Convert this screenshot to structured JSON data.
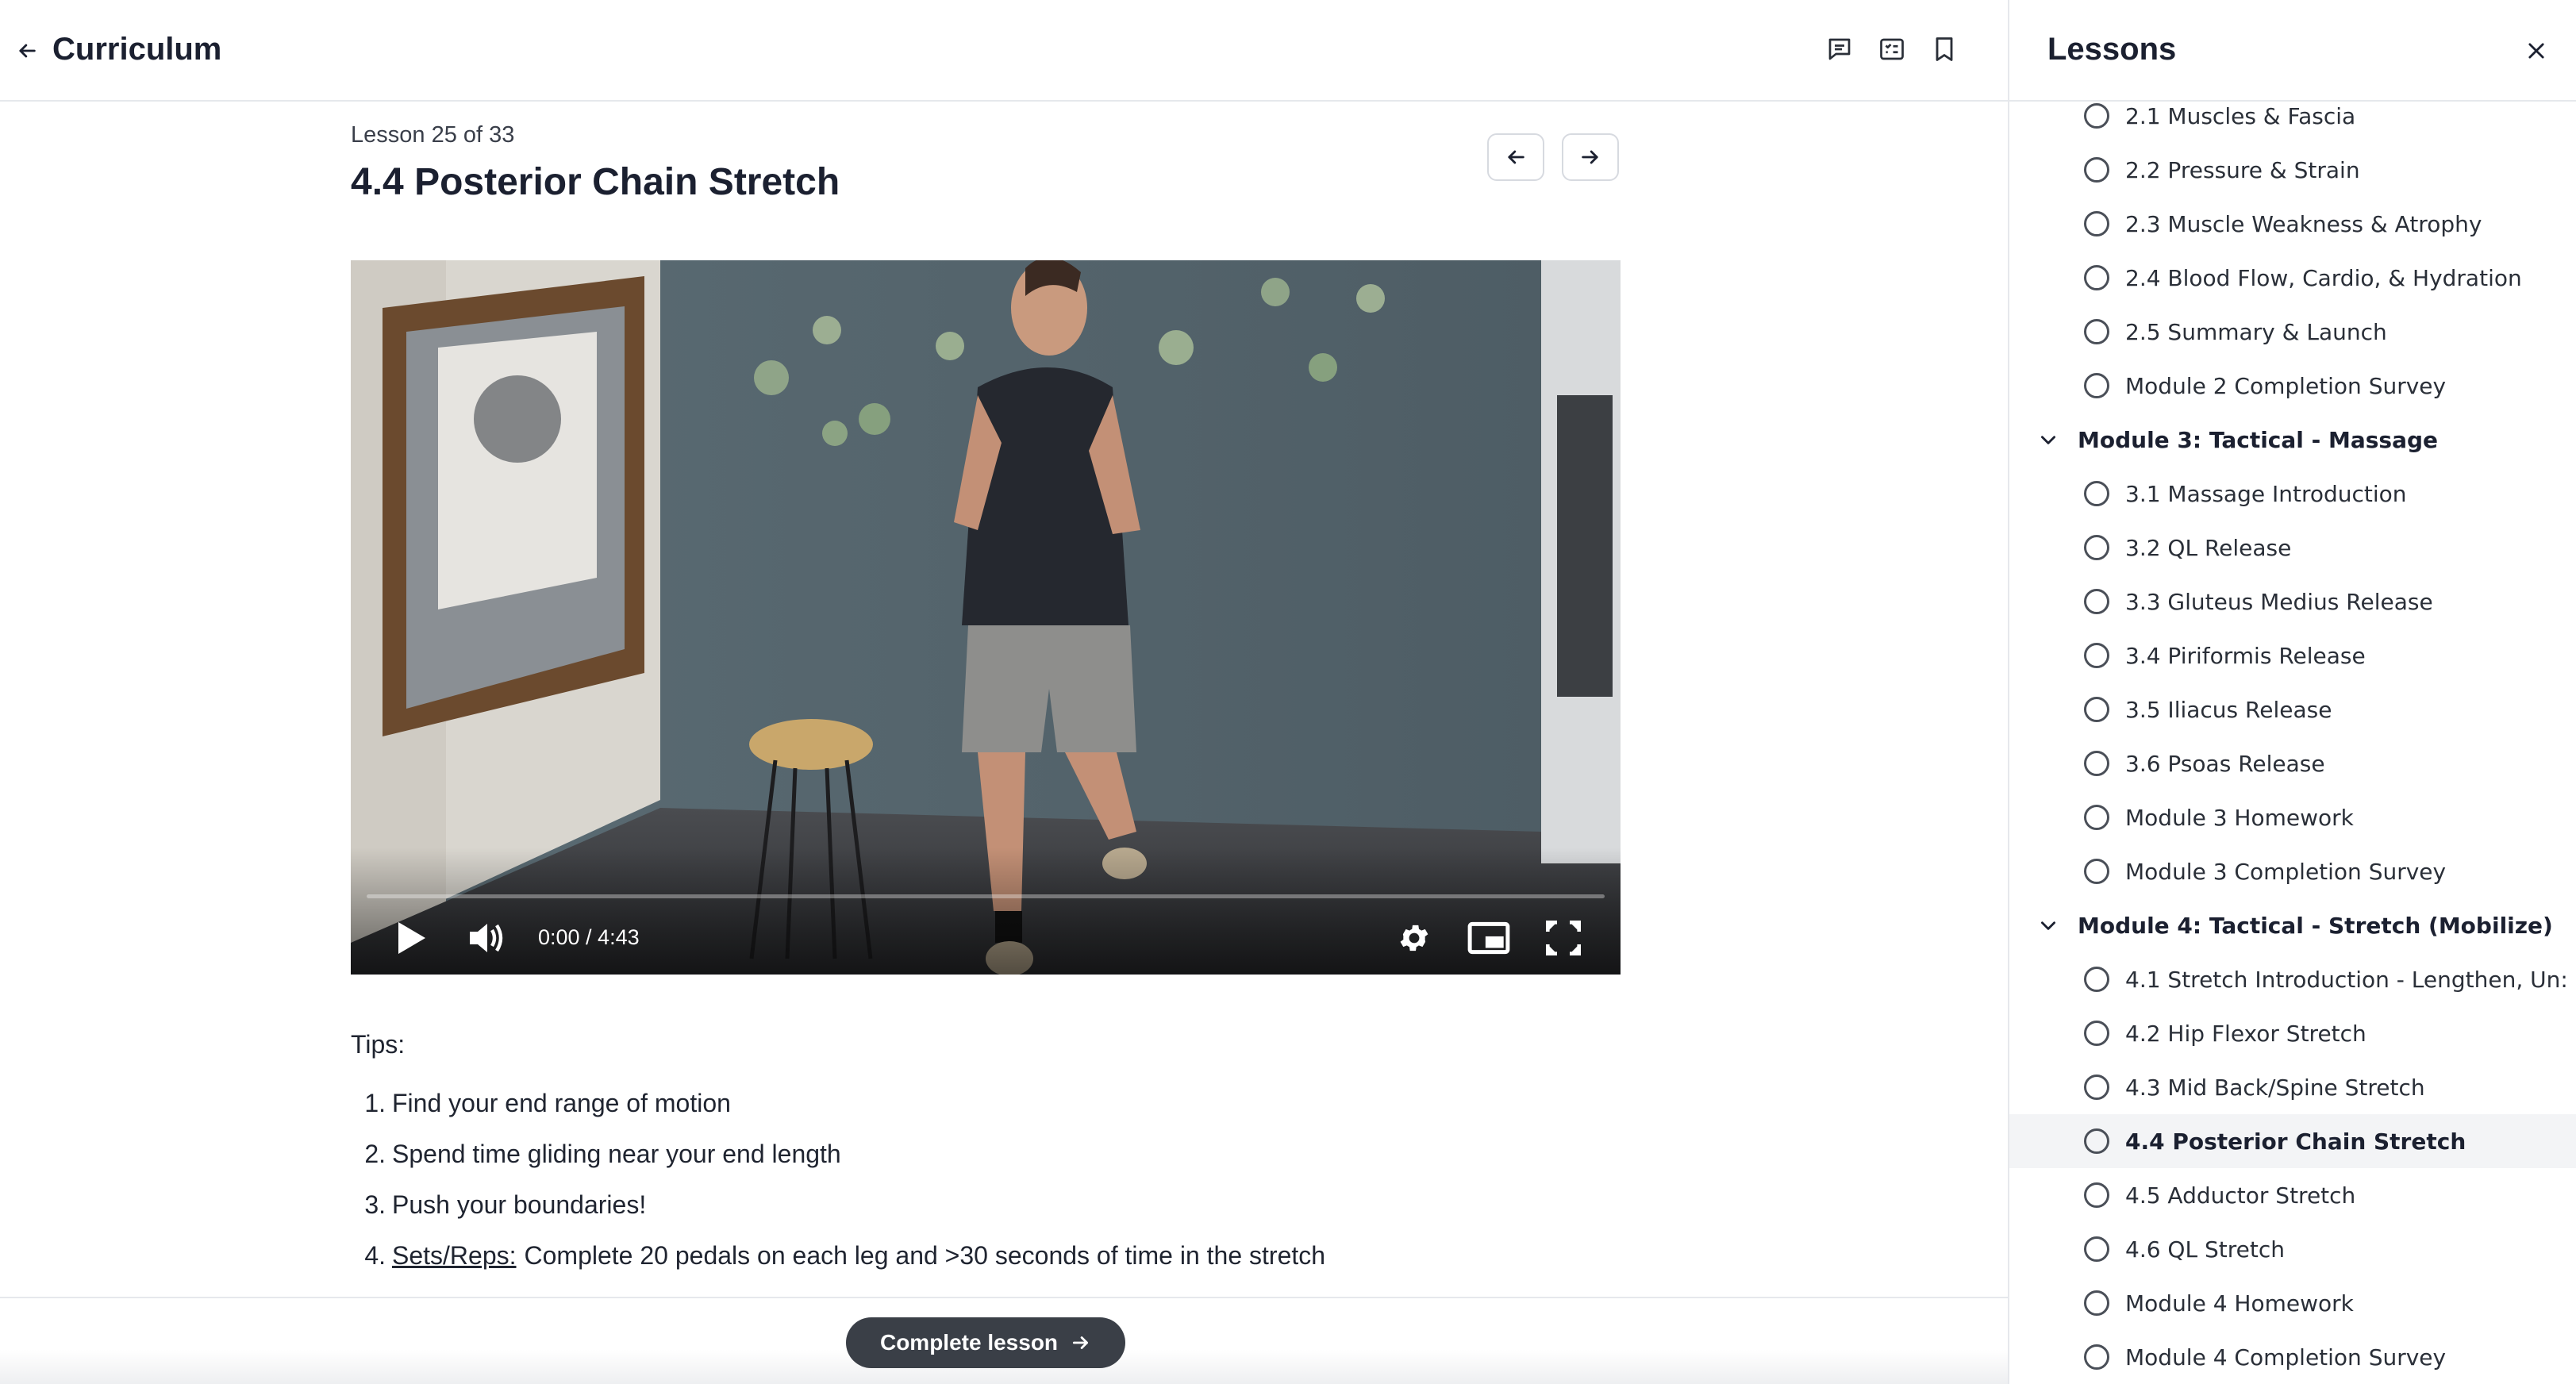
{
  "header": {
    "title": "Curriculum",
    "icons": [
      "comment-icon",
      "checklist-icon",
      "bookmark-icon"
    ]
  },
  "lesson": {
    "meta": "Lesson 25 of 33",
    "title": "4.4 Posterior Chain Stretch"
  },
  "video": {
    "time": "0:00 / 4:43",
    "progress": 0
  },
  "tips": {
    "heading": "Tips:",
    "items": [
      {
        "num": "1.",
        "text": "Find your end range of motion"
      },
      {
        "num": "2.",
        "text": "Spend time gliding near your end length"
      },
      {
        "num": "3.",
        "text": "Push your boundaries!"
      },
      {
        "num": "4.",
        "link": "Sets/Reps:",
        "text": "Complete 20 pedals on each leg and >30 seconds of time in the stretch"
      }
    ]
  },
  "footer": {
    "complete_label": "Complete lesson"
  },
  "sidebar": {
    "title": "Lessons",
    "rows": [
      {
        "type": "lesson",
        "label": "2.1 Muscles & Fascia"
      },
      {
        "type": "lesson",
        "label": "2.2 Pressure & Strain"
      },
      {
        "type": "lesson",
        "label": "2.3 Muscle Weakness & Atrophy"
      },
      {
        "type": "lesson",
        "label": "2.4 Blood Flow, Cardio, & Hydration"
      },
      {
        "type": "lesson",
        "label": "2.5 Summary & Launch"
      },
      {
        "type": "lesson",
        "label": "Module 2 Completion Survey"
      },
      {
        "type": "module",
        "label": "Module 3: Tactical - Massage"
      },
      {
        "type": "lesson",
        "label": "3.1 Massage Introduction"
      },
      {
        "type": "lesson",
        "label": "3.2 QL Release"
      },
      {
        "type": "lesson",
        "label": "3.3 Gluteus Medius Release"
      },
      {
        "type": "lesson",
        "label": "3.4 Piriformis Release"
      },
      {
        "type": "lesson",
        "label": "3.5 Iliacus Release"
      },
      {
        "type": "lesson",
        "label": "3.6 Psoas Release"
      },
      {
        "type": "lesson",
        "label": "Module 3 Homework"
      },
      {
        "type": "lesson",
        "label": "Module 3 Completion Survey"
      },
      {
        "type": "module",
        "label": "Module 4: Tactical - Stretch (Mobilize)"
      },
      {
        "type": "lesson",
        "label": "4.1 Stretch Introduction - Lengthen, Un:"
      },
      {
        "type": "lesson",
        "label": "4.2 Hip Flexor Stretch"
      },
      {
        "type": "lesson",
        "label": "4.3 Mid Back/Spine Stretch"
      },
      {
        "type": "lesson",
        "label": "4.4 Posterior Chain Stretch",
        "active": true
      },
      {
        "type": "lesson",
        "label": "4.5 Adductor Stretch"
      },
      {
        "type": "lesson",
        "label": "4.6 QL Stretch"
      },
      {
        "type": "lesson",
        "label": "Module 4 Homework"
      },
      {
        "type": "lesson",
        "label": "Module 4 Completion Survey"
      }
    ]
  }
}
